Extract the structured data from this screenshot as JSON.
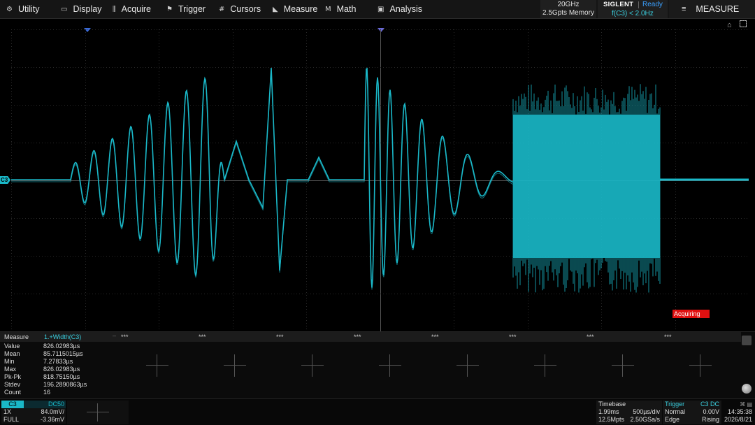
{
  "menu": {
    "items": [
      {
        "label": "Utility",
        "icon": "utility-icon",
        "glyph": "⚙"
      },
      {
        "label": "Display",
        "icon": "display-icon",
        "glyph": "▭"
      },
      {
        "label": "Acquire",
        "icon": "acquire-icon",
        "glyph": "⫼"
      },
      {
        "label": "Trigger",
        "icon": "trigger-icon",
        "glyph": "⚑"
      },
      {
        "label": "Cursors",
        "icon": "cursors-icon",
        "glyph": "#"
      },
      {
        "label": "Measure",
        "icon": "measure-icon",
        "glyph": "◣"
      },
      {
        "label": "Math",
        "icon": "math-icon",
        "glyph": "Μ"
      },
      {
        "label": "Analysis",
        "icon": "analysis-icon",
        "glyph": "▣"
      }
    ],
    "bandwidth": "20GHz",
    "memory": "2.5Gpts Memory",
    "brand": "SIGLENT",
    "state": "Ready",
    "frequency": "f(C3) < 2.0Hz",
    "measure_button": "MEASURE"
  },
  "waveform": {
    "channel": "C3",
    "color": "#1ab8c8",
    "status": "Acquiring"
  },
  "measure": {
    "title": "Measure",
    "item": "1.+Width(C3)",
    "stats": [
      {
        "label": "Value",
        "value": "826.02983µs"
      },
      {
        "label": "Mean",
        "value": "85.7115015µs"
      },
      {
        "label": "Min",
        "value": "7.27833µs"
      },
      {
        "label": "Max",
        "value": "826.02983µs"
      },
      {
        "label": "Pk-Pk",
        "value": "818.75150µs"
      },
      {
        "label": "Stdev",
        "value": "196.2890863µs"
      },
      {
        "label": "Count",
        "value": "16"
      }
    ],
    "slot_placeholder": "***"
  },
  "status": {
    "channel": {
      "name": "C3",
      "coupling": "DC50",
      "probe": "1X",
      "scale": "84.0mV/",
      "bandwidth": "FULL",
      "offset": "-3.36mV"
    },
    "timebase": {
      "title": "Timebase",
      "delay": "1.99ms",
      "scale": "500µs/div",
      "points": "12.5Mpts",
      "rate": "2.50GSa/s"
    },
    "trigger": {
      "title": "Trigger",
      "source": "C3 DC",
      "mode": "Normal",
      "level": "0.00V",
      "type": "Edge",
      "slope": "Rising"
    },
    "clock": {
      "time": "14:35:38",
      "date": "2026/8/21"
    }
  }
}
